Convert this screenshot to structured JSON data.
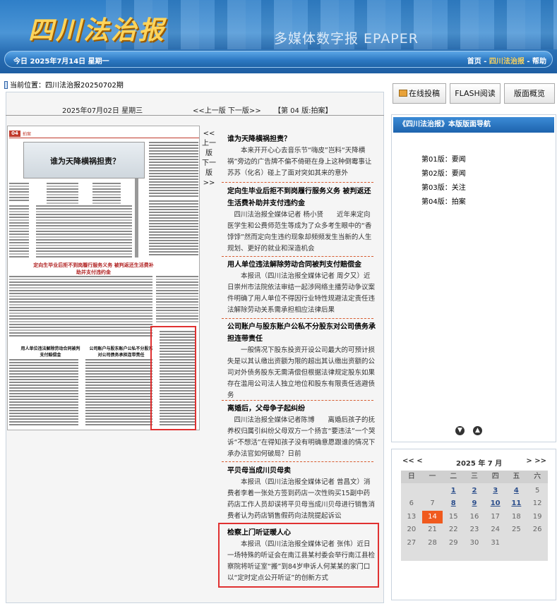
{
  "banner": {
    "logo": "四川法治报",
    "epaper": "多媒体数字报 EPAPER",
    "today": "今日 2025年7月14日 星期一",
    "links": [
      "首页",
      "四川法治报",
      "帮助"
    ]
  },
  "breadcrumb": "当前位置：四川法治报20250702期",
  "pagenav": {
    "date": "2025年07月02日 星期三",
    "prev_next": "<<上一版  下一版>>",
    "edition": "【第 04 版:拍案】"
  },
  "side_prevnext": "<<上一版 下一版>>",
  "articles": [
    {
      "title": "谁为天降横祸担责？",
      "text": "本来开开心心去音乐节“嗨皮”岂料“天降横祸”旁边的广告牌不偏不倚砸在身上这种倒霉事让苏苏（化名）碰上了面对突如其来的意外"
    },
    {
      "title": "定向生毕业后拒不到岗履行服务义务 被判返还生活费补助并支付违约金",
      "text": "四川法治报全媒体记者 杨小贤　　近年来定向医学生和公费师范生等成为了众多考生眼中的“香饽饽”然而定向生违约现象却频频发生当新的人生规划、更好的就业和深造机会"
    },
    {
      "title": "用人单位违法解除劳动合同被判支付赔偿金",
      "text": "本报讯（四川法治报全媒体记者 周夕又）近日崇州市法院依法审结一起涉网络主播劳动争议案件明确了用人单位不得因行业特性规避法定责任违法解除劳动关系需承担相应法律后果"
    },
    {
      "title": "公司账户与股东账户公私不分股东对公司债务承担连带责任",
      "text": "一般情况下股东投资开设公司最大的可预计损失是以其认缴出资额为限的超出其认缴出资额的公司对外债务股东无需清偿但根据法律规定股东如果存在滥用公司法人独立地位和股东有限责任逃避债务"
    },
    {
      "title": "离婚后，父母争子起纠纷",
      "text": "四川法治报全媒体记者陈博　　离婚后孩子的抚养权归属引纠纷父母双方一个扬言“要违法”一个哭诉“不想活”在得知孩子没有明确意愿跟谁的情况下承办法官如何破局？日前"
    },
    {
      "title": "平贝母当成川贝母卖",
      "text": "本报讯（四川法治报全媒体记者 曾昌文）消费者李着一张处方签到药店一次性购买15副中药药店工作人员却误将平贝母当成川贝母进行销售消费者认为药店销售假药向法院提起诉讼"
    },
    {
      "title": "检察上门听证暖人心",
      "text": "本报讯（四川法治报全媒体记者 张伟）近日一场特殊的听证会在南江县某村委会举行南江县检察院将听证室“搬”到84岁申诉人何某某的家门口以“定时定点公开听证”的创新方式"
    }
  ],
  "thumb": {
    "page_no": "04",
    "section": "拍案",
    "headline": "谁为天降横祸担责？",
    "h2": "定向生毕业后拒不到岗履行服务义务 被判返还生活费补助并支付违约金",
    "h3": "用人单位违法解除劳动合同被判支付赔偿金",
    "h4": "公司账户与股东账户公私不分股东对公司债务承担连带责任"
  },
  "buttons": [
    "在线投稿",
    "FLASH阅读",
    "版面概览"
  ],
  "navpanel": {
    "title": "《四川法治报》本版版面导航",
    "items": [
      "第01版：要闻",
      "第02版：要闻",
      "第03版：关注",
      "第04版：拍案"
    ]
  },
  "calendar": {
    "prev": "<< <",
    "month": "2025 年 7 月",
    "next": "> >>",
    "weekdays": [
      "日",
      "一",
      "二",
      "三",
      "四",
      "五",
      "六"
    ],
    "days": [
      "",
      "",
      "1",
      "2",
      "3",
      "4",
      "5",
      "6",
      "7",
      "8",
      "9",
      "10",
      "11",
      "12",
      "13",
      "14",
      "15",
      "16",
      "17",
      "18",
      "19",
      "20",
      "21",
      "22",
      "23",
      "24",
      "25",
      "26",
      "27",
      "28",
      "29",
      "30",
      "31",
      "",
      ""
    ],
    "linked": [
      "1",
      "2",
      "3",
      "4",
      "8",
      "9",
      "10",
      "11"
    ],
    "today": "14"
  },
  "colors": {
    "accent": "#1e63ad",
    "highlight": "#e03131",
    "today": "#f05a1e"
  }
}
